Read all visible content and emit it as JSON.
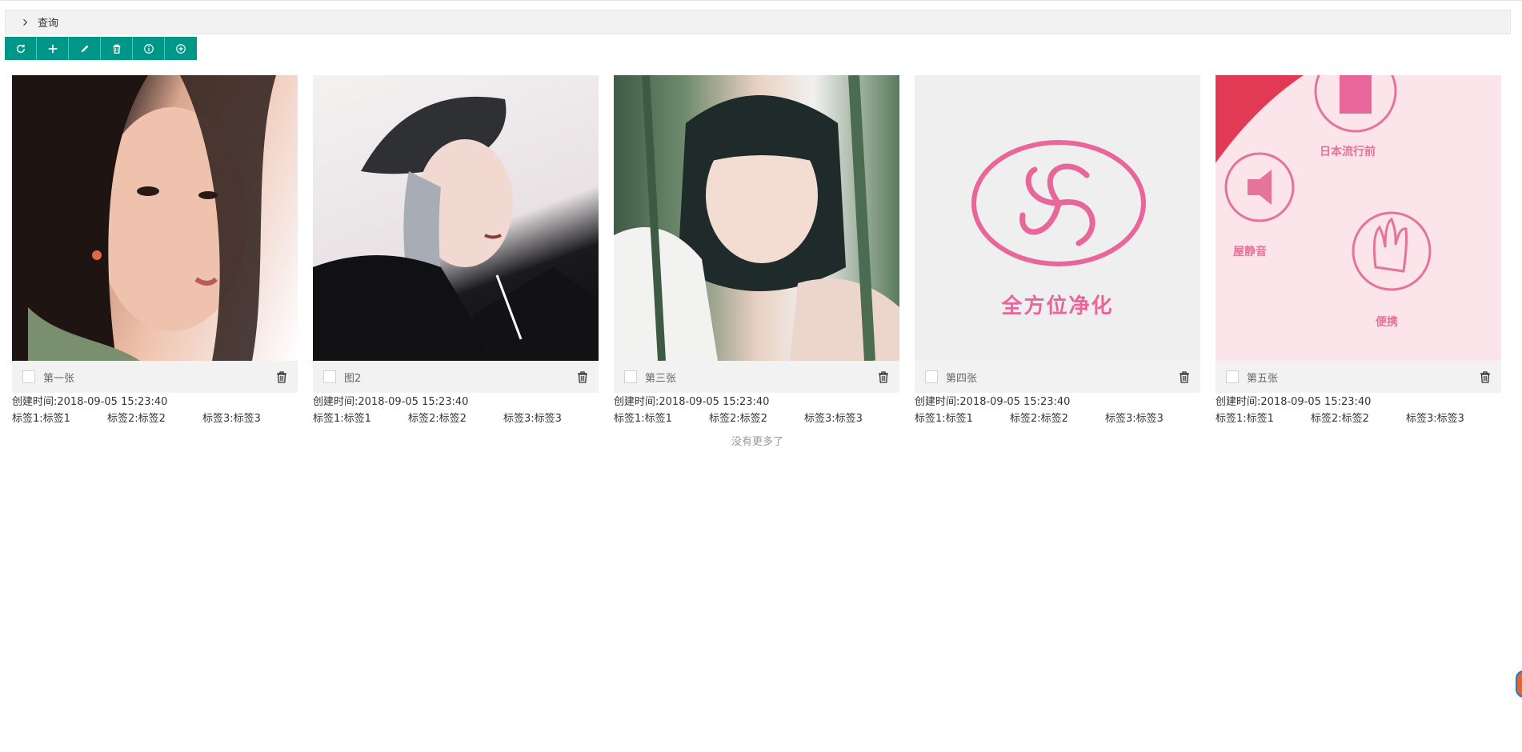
{
  "query": {
    "label": "查询",
    "chevron_icon": "chevron-right-icon"
  },
  "toolbar": {
    "color": "#009688",
    "buttons": [
      {
        "name": "refresh-button",
        "icon": "refresh-icon"
      },
      {
        "name": "add-button",
        "icon": "plus-icon"
      },
      {
        "name": "edit-button",
        "icon": "pencil-icon"
      },
      {
        "name": "delete-button",
        "icon": "trash-icon"
      },
      {
        "name": "info-button",
        "icon": "info-icon"
      },
      {
        "name": "add-circle-button",
        "icon": "plus-circle-icon"
      }
    ]
  },
  "cards": [
    {
      "title": "第一张",
      "created": "创建时间:2018-09-05 15:23:40",
      "tags": [
        "标签1:标签1",
        "标签2:标签2",
        "标签3:标签3"
      ]
    },
    {
      "title": "图2",
      "created": "创建时间:2018-09-05 15:23:40",
      "tags": [
        "标签1:标签1",
        "标签2:标签2",
        "标签3:标签3"
      ]
    },
    {
      "title": "第三张",
      "created": "创建时间:2018-09-05 15:23:40",
      "tags": [
        "标签1:标签1",
        "标签2:标签2",
        "标签3:标签3"
      ]
    },
    {
      "title": "第四张",
      "created": "创建时间:2018-09-05 15:23:40",
      "tags": [
        "标签1:标签1",
        "标签2:标签2",
        "标签3:标签3"
      ]
    },
    {
      "title": "第五张",
      "created": "创建时间:2018-09-05 15:23:40",
      "tags": [
        "标签1:标签1",
        "标签2:标签2",
        "标签3:标签3"
      ]
    }
  ],
  "images": {
    "card4_text": "全方位净化",
    "card5_labels": [
      "日本流行前",
      "屋静音",
      "便携"
    ]
  },
  "status": {
    "no_more": "没有更多了"
  }
}
